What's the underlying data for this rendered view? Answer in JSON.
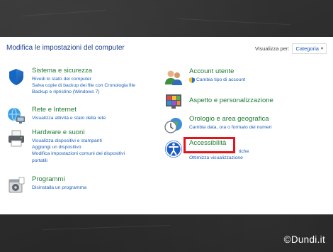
{
  "header": {
    "title": "Modifica le impostazioni del computer",
    "view_by_label": "Visualizza per:",
    "view_by_value": "Categoria"
  },
  "left_categories": [
    {
      "title": "Sistema e sicurezza",
      "icon": "shield-icon",
      "links": [
        "Rivedi lo stato del computer",
        "Salva copie di backup dei file con Cronologia file",
        "Backup e ripristino (Windows 7)"
      ]
    },
    {
      "title": "Rete e Internet",
      "icon": "network-icon",
      "links": [
        "Visualizza attività e stato della rete"
      ]
    },
    {
      "title": "Hardware e suoni",
      "icon": "printer-icon",
      "links": [
        "Visualizza dispositivi e stampanti",
        "Aggiungi un dispositivo",
        "Modifica impostazioni comuni dei dispositivi",
        "portatili"
      ]
    },
    {
      "title": "Programmi",
      "icon": "programs-icon",
      "links": [
        "Disinstalla un programma"
      ]
    }
  ],
  "right_categories": [
    {
      "title": "Account utente",
      "icon": "users-icon",
      "links": [
        "Cambia tipo di account"
      ]
    },
    {
      "title": "Aspetto e personalizzazione",
      "icon": "appearance-icon",
      "links": []
    },
    {
      "title": "Orologio e area geografica",
      "icon": "clock-globe-icon",
      "links": [
        "Cambia data, ora o formato dei numeri"
      ]
    },
    {
      "title": "Accessibilità",
      "icon": "accessibility-icon",
      "links": [
        "tiche",
        "Ottimizza visualizzazione"
      ]
    }
  ],
  "watermark": "©Dundi.it",
  "colors": {
    "link": "#1d5fb6",
    "category_title": "#1f7a34",
    "header": "#1a3e8c",
    "highlight": "#e4141c",
    "background": "#2b2b2b"
  }
}
